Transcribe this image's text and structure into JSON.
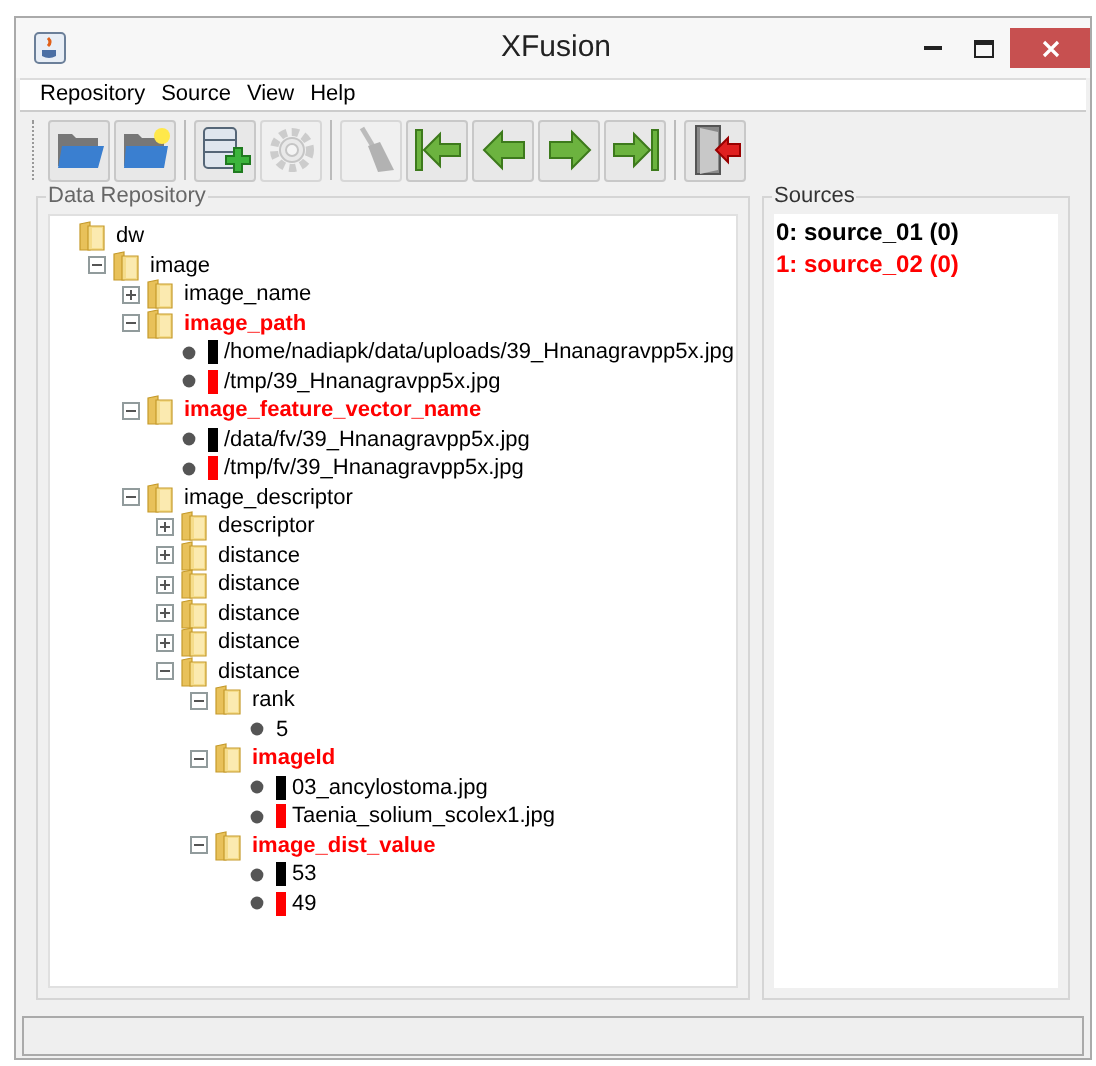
{
  "window": {
    "title": "XFusion"
  },
  "menu": [
    "Repository",
    "Source",
    "View",
    "Help"
  ],
  "toolbar": [
    {
      "kind": "open-folder",
      "disabled": false
    },
    {
      "kind": "new-folder",
      "disabled": false
    },
    {
      "kind": "separator"
    },
    {
      "kind": "add-database",
      "disabled": false
    },
    {
      "kind": "gear",
      "disabled": true
    },
    {
      "kind": "separator"
    },
    {
      "kind": "broom",
      "disabled": true
    },
    {
      "kind": "first",
      "disabled": false
    },
    {
      "kind": "previous",
      "disabled": false
    },
    {
      "kind": "next",
      "disabled": false
    },
    {
      "kind": "last",
      "disabled": false
    },
    {
      "kind": "separator"
    },
    {
      "kind": "exit",
      "disabled": false
    }
  ],
  "repository": {
    "title": "Data Repository",
    "tree": [
      {
        "kind": "folder",
        "label": "dw",
        "highlighted": false,
        "children": [
          {
            "kind": "folder",
            "label": "image",
            "expanded": true,
            "highlighted": false,
            "children": [
              {
                "kind": "folder",
                "label": "image_name",
                "expanded": false,
                "highlighted": false
              },
              {
                "kind": "folder",
                "label": "image_path",
                "expanded": true,
                "highlighted": true,
                "children": [
                  {
                    "kind": "leaf",
                    "label": "/home/nadiapk/data/uploads/39_Hnanagravpp5x.jpg",
                    "color": "#000000"
                  },
                  {
                    "kind": "leaf",
                    "label": "/tmp/39_Hnanagravpp5x.jpg",
                    "color": "#ff0000"
                  }
                ]
              },
              {
                "kind": "folder",
                "label": "image_feature_vector_name",
                "expanded": true,
                "highlighted": true,
                "children": [
                  {
                    "kind": "leaf",
                    "label": "/data/fv/39_Hnanagravpp5x.jpg",
                    "color": "#000000"
                  },
                  {
                    "kind": "leaf",
                    "label": "/tmp/fv/39_Hnanagravpp5x.jpg",
                    "color": "#ff0000"
                  }
                ]
              },
              {
                "kind": "folder",
                "label": "image_descriptor",
                "expanded": true,
                "highlighted": false,
                "children": [
                  {
                    "kind": "folder",
                    "label": "descriptor",
                    "expanded": false,
                    "highlighted": false
                  },
                  {
                    "kind": "folder",
                    "label": "distance",
                    "expanded": false,
                    "highlighted": false
                  },
                  {
                    "kind": "folder",
                    "label": "distance",
                    "expanded": false,
                    "highlighted": false
                  },
                  {
                    "kind": "folder",
                    "label": "distance",
                    "expanded": false,
                    "highlighted": false
                  },
                  {
                    "kind": "folder",
                    "label": "distance",
                    "expanded": false,
                    "highlighted": false
                  },
                  {
                    "kind": "folder",
                    "label": "distance",
                    "expanded": true,
                    "highlighted": false,
                    "children": [
                      {
                        "kind": "folder",
                        "label": "rank",
                        "expanded": true,
                        "highlighted": false,
                        "children": [
                          {
                            "kind": "leaf",
                            "label": "5"
                          }
                        ]
                      },
                      {
                        "kind": "folder",
                        "label": "imageId",
                        "expanded": true,
                        "highlighted": true,
                        "children": [
                          {
                            "kind": "leaf",
                            "label": "03_ancylostoma.jpg",
                            "color": "#000000"
                          },
                          {
                            "kind": "leaf",
                            "label": "Taenia_solium_scolex1.jpg",
                            "color": "#ff0000"
                          }
                        ]
                      },
                      {
                        "kind": "folder",
                        "label": "image_dist_value",
                        "expanded": true,
                        "highlighted": true,
                        "children": [
                          {
                            "kind": "leaf",
                            "label": "53",
                            "color": "#000000"
                          },
                          {
                            "kind": "leaf",
                            "label": "49",
                            "color": "#ff0000"
                          }
                        ]
                      }
                    ]
                  }
                ]
              }
            ]
          }
        ]
      }
    ]
  },
  "sources": {
    "title": "Sources",
    "items": [
      {
        "label": "0: source_01 (0)",
        "color": "#000000"
      },
      {
        "label": "1: source_02 (0)",
        "color": "#ff0000"
      }
    ]
  }
}
